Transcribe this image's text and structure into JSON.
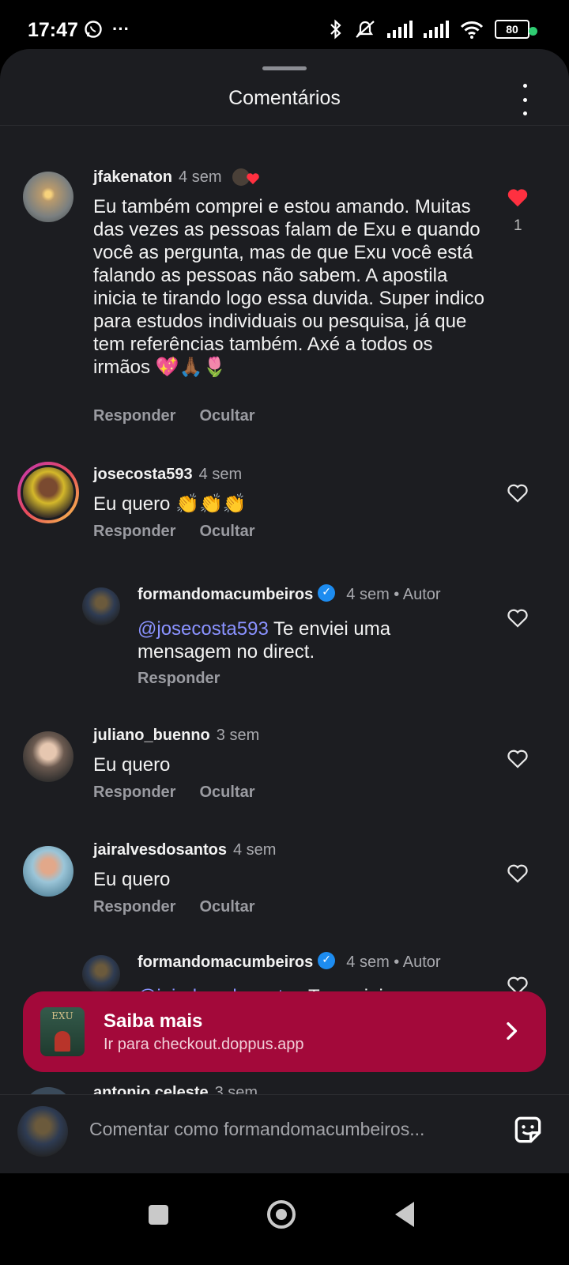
{
  "status_bar": {
    "time": "17:47",
    "more": "···",
    "battery": "80"
  },
  "sheet": {
    "title": "Comentários"
  },
  "comments": [
    {
      "username": "jfakenaton",
      "time": "4 sem",
      "text": "Eu também comprei e estou amando. Muitas das vezes as pessoas falam de Exu e quando você as pergunta, mas de que Exu você está falando as pessoas não sabem. A apostila inicia te tirando logo essa duvida. Super indico para estudos individuais ou pesquisa, já que tem referências também. Axé a todos os irmãos 💖🙏🏾🌷",
      "reply": "Responder",
      "hide": "Ocultar",
      "likes": "1",
      "liked": true
    },
    {
      "username": "josecosta593",
      "time": "4 sem",
      "text": "Eu quero 👏👏👏",
      "reply": "Responder",
      "hide": "Ocultar"
    },
    {
      "username": "formandomacumbeiros",
      "time": "4 sem",
      "author_label": "Autor",
      "mention": "@josecosta593",
      "text": " Te enviei uma mensagem no direct.",
      "reply": "Responder"
    },
    {
      "username": "juliano_buenno",
      "time": "3 sem",
      "text": "Eu quero",
      "reply": "Responder",
      "hide": "Ocultar"
    },
    {
      "username": "jairalvesdosantos",
      "time": "4 sem",
      "text": "Eu quero",
      "reply": "Responder",
      "hide": "Ocultar"
    },
    {
      "username": "formandomacumbeiros",
      "time": "4 sem",
      "author_label": "Autor",
      "mention": "@jairalvesdosantos",
      "text": " Te enviei uma"
    },
    {
      "username": "antonio.celeste",
      "time": "3 sem"
    }
  ],
  "banner": {
    "title": "Saiba mais",
    "subtitle": "Ir para checkout.doppus.app",
    "thumb_text": "EXU"
  },
  "composer": {
    "placeholder": "Comentar como formandomacumbeiros..."
  },
  "colors": {
    "sheet": "#1c1d21",
    "banner": "#a3093a",
    "like_red": "#ff3040",
    "mention": "#8a92ff",
    "verified": "#1d8cf0"
  }
}
